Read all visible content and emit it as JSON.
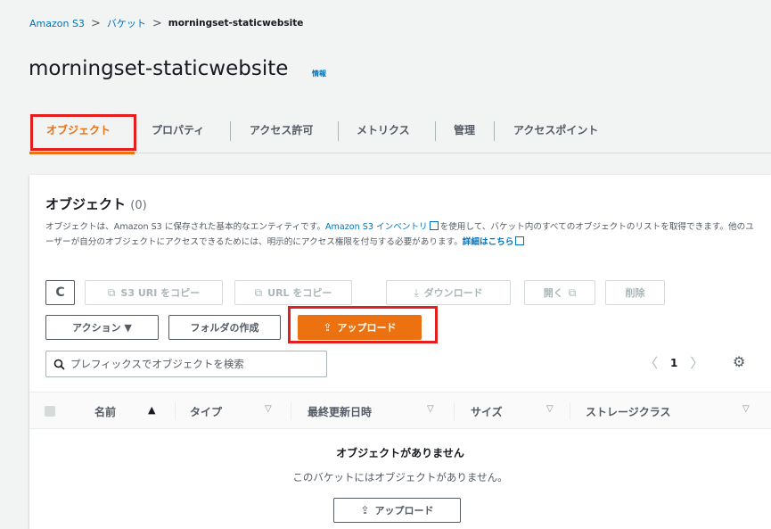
{
  "breadcrumb": {
    "root": "Amazon S3",
    "bucket": "バケット",
    "current": "morningset-staticwebsite"
  },
  "page": {
    "title": "morningset-staticwebsite",
    "info": "情報"
  },
  "tabs": [
    "オブジェクト",
    "プロパティ",
    "アクセス許可",
    "メトリクス",
    "管理",
    "アクセスポイント"
  ],
  "panel": {
    "title": "オブジェクト",
    "count": "(0)",
    "desc_1": "オブジェクトは、Amazon S3 に保存された基本的なエンティティです。",
    "desc_link": "Amazon S3 インベントリ",
    "desc_2": "を使用して、バケット内のすべてのオブジェクトのリストを取得できます。他のユーザーが自分のオブジェクトにアクセスできるためには、明示的にアクセス権限を付与する必要があります。",
    "desc_more": "詳細はこちら"
  },
  "toolbar": {
    "refresh": "C",
    "copy_s3_uri": "S3 URI をコピー",
    "copy_url": "URL をコピー",
    "download": "ダウンロード",
    "open": "開く",
    "delete": "削除",
    "actions": "アクション ▼",
    "create_folder": "フォルダの作成",
    "upload": "アップロード"
  },
  "search": {
    "placeholder": "プレフィックスでオブジェクトを検索"
  },
  "pager": {
    "prev": "〈",
    "page": "1",
    "next": "〉"
  },
  "table": {
    "columns": [
      "名前",
      "タイプ",
      "最終更新日時",
      "サイズ",
      "ストレージクラス"
    ]
  },
  "empty": {
    "title": "オブジェクトがありません",
    "subtitle": "このバケットにはオブジェクトがありません。",
    "upload": "アップロード"
  },
  "colors": {
    "accent": "#ec7211",
    "link": "#0073bb",
    "highlight": "#e41d1d"
  },
  "icons": [
    "refresh-icon",
    "copy-icon",
    "download-icon",
    "external-link-icon",
    "upload-icon",
    "search-icon",
    "settings-icon",
    "sort-icon"
  ]
}
